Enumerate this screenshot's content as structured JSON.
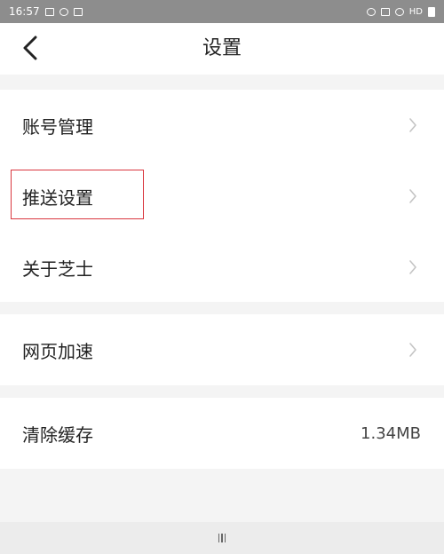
{
  "status_bar": {
    "time": "16:57",
    "right_text": "HD",
    "left_icons": [
      "image-icon",
      "camera-icon",
      "sim-icon"
    ],
    "right_icons": [
      "alarm-icon",
      "mute-icon",
      "wifi-icon",
      "battery-icon"
    ]
  },
  "nav": {
    "title": "设置",
    "back_icon": "chevron-left-icon"
  },
  "settings": {
    "account": {
      "label": "账号管理"
    },
    "push": {
      "label": "推送设置"
    },
    "about": {
      "label": "关于芝士"
    },
    "web_speedup": {
      "label": "网页加速"
    },
    "clear_cache": {
      "label": "清除缓存",
      "value": "1.34MB"
    }
  },
  "colors": {
    "highlight": "#d9363e",
    "chevron": "#c4c4c4"
  }
}
